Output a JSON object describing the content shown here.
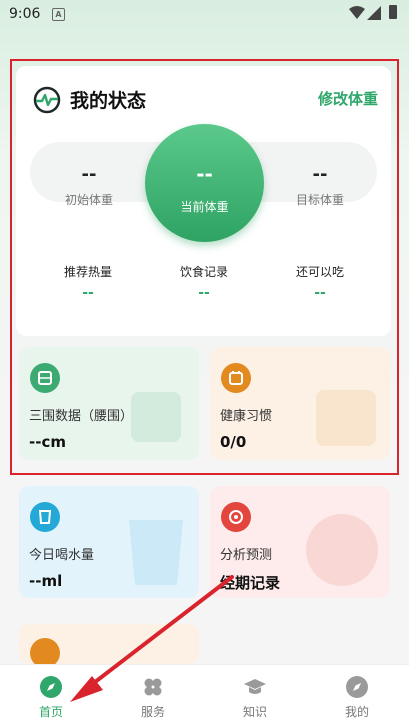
{
  "status_bar": {
    "time": "9:06"
  },
  "status_card": {
    "title": "我的状态",
    "edit_label": "修改体重",
    "initial_weight": {
      "value": "--",
      "label": "初始体重"
    },
    "current_weight": {
      "value": "--",
      "label": "当前体重"
    },
    "target_weight": {
      "value": "--",
      "label": "目标体重"
    },
    "stats": [
      {
        "label": "推荐热量",
        "value": "--"
      },
      {
        "label": "饮食记录",
        "value": "--"
      },
      {
        "label": "还可以吃",
        "value": "--"
      }
    ]
  },
  "tiles": {
    "measurements": {
      "title": "三围数据（腰围）",
      "value": "--cm"
    },
    "habits": {
      "title": "健康习惯",
      "value": "0/0"
    },
    "water": {
      "title": "今日喝水量",
      "value": "--ml"
    },
    "period": {
      "title": "分析预测",
      "value": "经期记录"
    }
  },
  "tab_bar": {
    "items": [
      {
        "label": "首页",
        "icon": "compass-icon",
        "active": true
      },
      {
        "label": "服务",
        "icon": "clover-icon",
        "active": false
      },
      {
        "label": "知识",
        "icon": "graduation-cap-icon",
        "active": false
      },
      {
        "label": "我的",
        "icon": "compass-outline-icon",
        "active": false
      }
    ]
  },
  "colors": {
    "accent": "#2fa66a",
    "highlight_box": "#d9232d",
    "arrow": "#d9232d"
  }
}
